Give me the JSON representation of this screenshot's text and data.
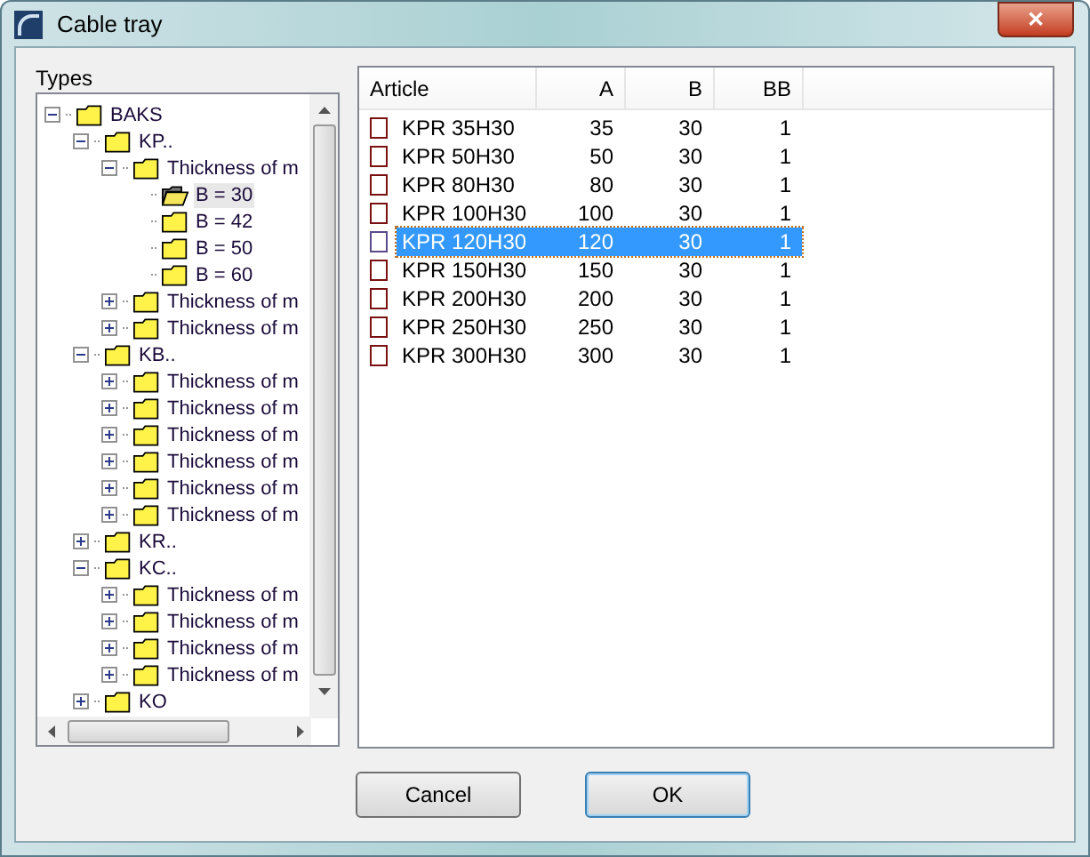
{
  "window": {
    "title": "Cable tray",
    "close": "✕"
  },
  "types": {
    "label": "Types",
    "tree": [
      {
        "label": "BAKS",
        "expanded": true,
        "selected": false,
        "children": [
          {
            "label": "KP..",
            "expanded": true,
            "selected": false,
            "children": [
              {
                "label": "Thickness of m",
                "expanded": true,
                "selected": false,
                "children": [
                  {
                    "label": "B = 30",
                    "selected": true
                  },
                  {
                    "label": "B = 42",
                    "selected": false
                  },
                  {
                    "label": "B = 50",
                    "selected": false
                  },
                  {
                    "label": "B = 60",
                    "selected": false
                  }
                ]
              },
              {
                "label": "Thickness of m",
                "expanded": false,
                "selected": false
              },
              {
                "label": "Thickness of m",
                "expanded": false,
                "selected": false
              }
            ]
          },
          {
            "label": "KB..",
            "expanded": true,
            "selected": false,
            "children": [
              {
                "label": "Thickness of m",
                "expanded": false,
                "selected": false
              },
              {
                "label": "Thickness of m",
                "expanded": false,
                "selected": false
              },
              {
                "label": "Thickness of m",
                "expanded": false,
                "selected": false
              },
              {
                "label": "Thickness of m",
                "expanded": false,
                "selected": false
              },
              {
                "label": "Thickness of m",
                "expanded": false,
                "selected": false
              },
              {
                "label": "Thickness of m",
                "expanded": false,
                "selected": false
              }
            ]
          },
          {
            "label": "KR..",
            "expanded": false,
            "selected": false
          },
          {
            "label": "KC..",
            "expanded": true,
            "selected": false,
            "children": [
              {
                "label": "Thickness of m",
                "expanded": false,
                "selected": false
              },
              {
                "label": "Thickness of m",
                "expanded": false,
                "selected": false
              },
              {
                "label": "Thickness of m",
                "expanded": false,
                "selected": false
              },
              {
                "label": "Thickness of m",
                "expanded": false,
                "selected": false
              }
            ]
          },
          {
            "label": "KO",
            "expanded": false,
            "selected": false
          }
        ]
      }
    ]
  },
  "table": {
    "columns": [
      "Article",
      "A",
      "B",
      "BB"
    ],
    "rows": [
      {
        "cells": [
          "KPR 35H30",
          "35",
          "30",
          "1"
        ],
        "checked": false,
        "selected": false
      },
      {
        "cells": [
          "KPR 50H30",
          "50",
          "30",
          "1"
        ],
        "checked": false,
        "selected": false
      },
      {
        "cells": [
          "KPR 80H30",
          "80",
          "30",
          "1"
        ],
        "checked": false,
        "selected": false
      },
      {
        "cells": [
          "KPR 100H30",
          "100",
          "30",
          "1"
        ],
        "checked": false,
        "selected": false
      },
      {
        "cells": [
          "KPR 120H30",
          "120",
          "30",
          "1"
        ],
        "checked": false,
        "selected": true
      },
      {
        "cells": [
          "KPR 150H30",
          "150",
          "30",
          "1"
        ],
        "checked": false,
        "selected": false
      },
      {
        "cells": [
          "KPR 200H30",
          "200",
          "30",
          "1"
        ],
        "checked": false,
        "selected": false
      },
      {
        "cells": [
          "KPR 250H30",
          "250",
          "30",
          "1"
        ],
        "checked": false,
        "selected": false
      },
      {
        "cells": [
          "KPR 300H30",
          "300",
          "30",
          "1"
        ],
        "checked": false,
        "selected": false
      }
    ]
  },
  "buttons": [
    "Cancel",
    "OK"
  ]
}
